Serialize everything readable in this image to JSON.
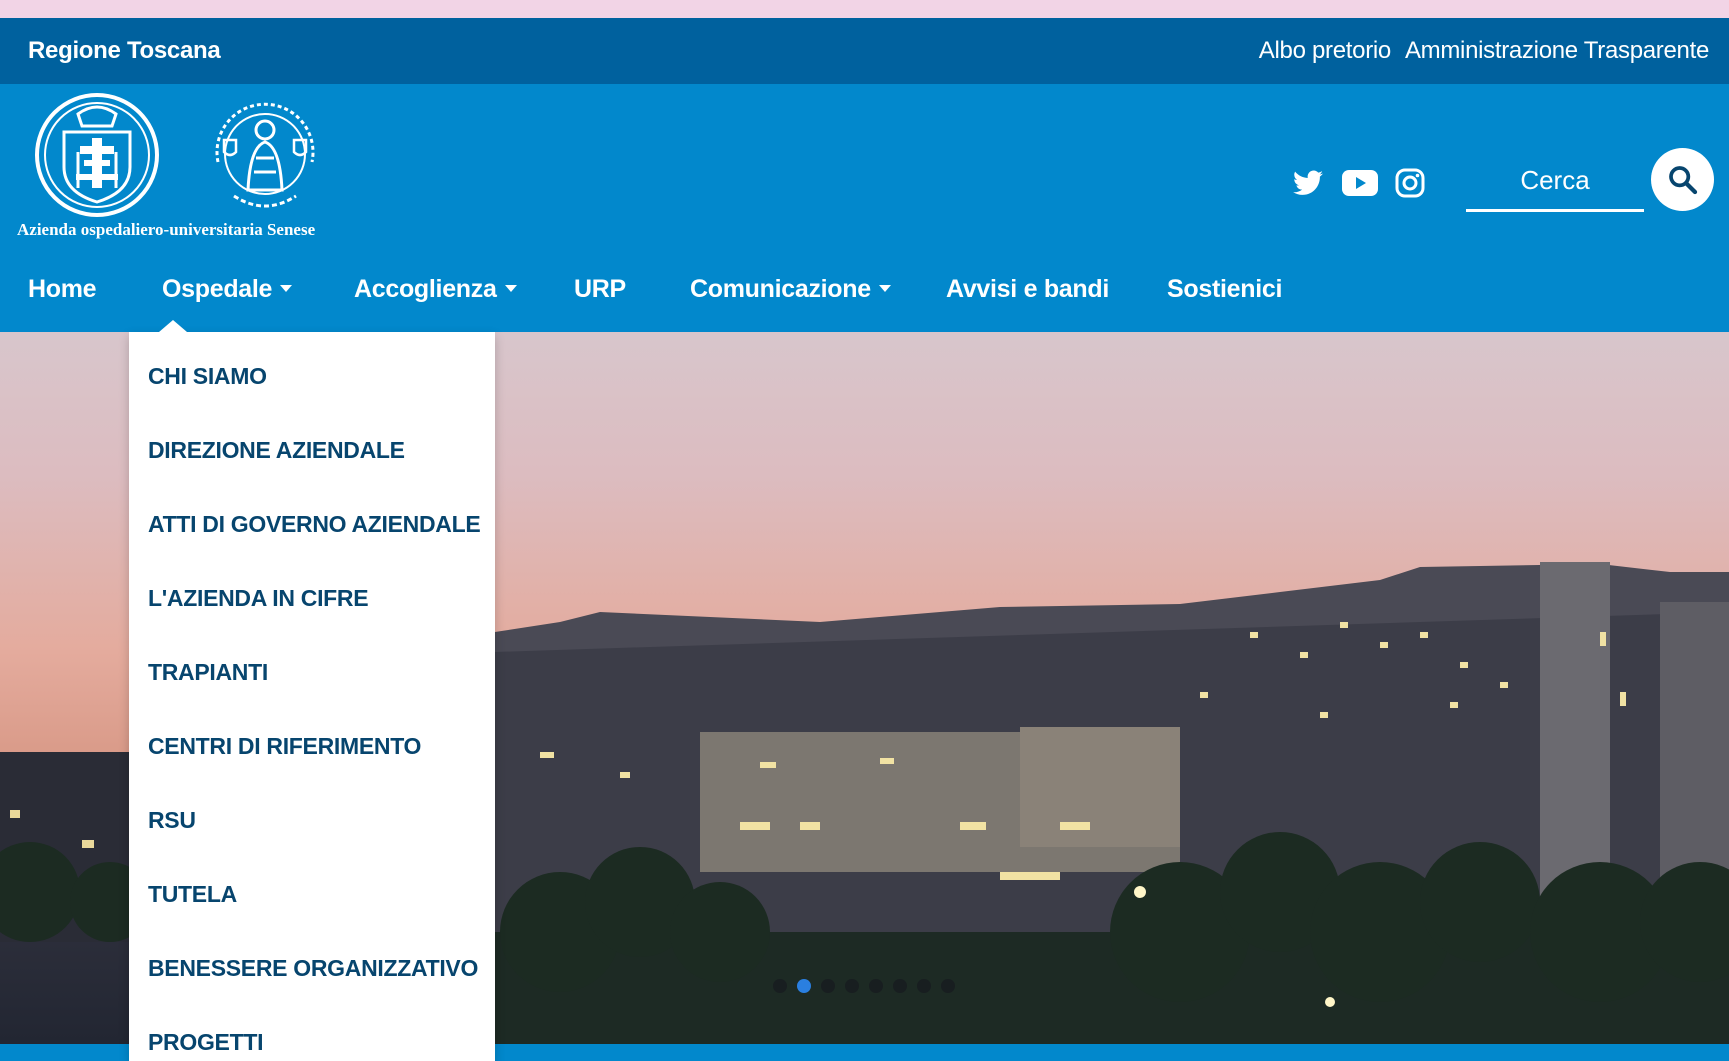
{
  "topbar": {
    "region": "Regione Toscana",
    "links": [
      "Albo pretorio",
      "Amministrazione Trasparente"
    ]
  },
  "header": {
    "logo_caption": "Azienda ospedaliero-universitaria Senese",
    "social_icons": [
      "twitter-icon",
      "youtube-icon",
      "instagram-icon"
    ],
    "search_placeholder": "Cerca",
    "search_icon": "search-icon"
  },
  "nav": {
    "items": [
      "Home",
      "Ospedale",
      "Accoglienza",
      "URP",
      "Comunicazione",
      "Avvisi e bandi",
      "Sostienici"
    ]
  },
  "dropdown": {
    "items": [
      "CHI SIAMO",
      "DIREZIONE AZIENDALE",
      "ATTI DI GOVERNO AZIENDALE",
      "L'AZIENDA IN CIFRE",
      "TRAPIANTI",
      "CENTRI DI RIFERIMENTO",
      "RSU",
      "TUTELA",
      "BENESSERE ORGANIZZATIVO",
      "PROGETTI"
    ]
  },
  "carousel": {
    "slide_count": 8,
    "active_index": 1
  },
  "colors": {
    "topbar": "#00619e",
    "header": "#0288cc",
    "menu_text": "#07456e",
    "active_dot": "#2a7fe0"
  }
}
